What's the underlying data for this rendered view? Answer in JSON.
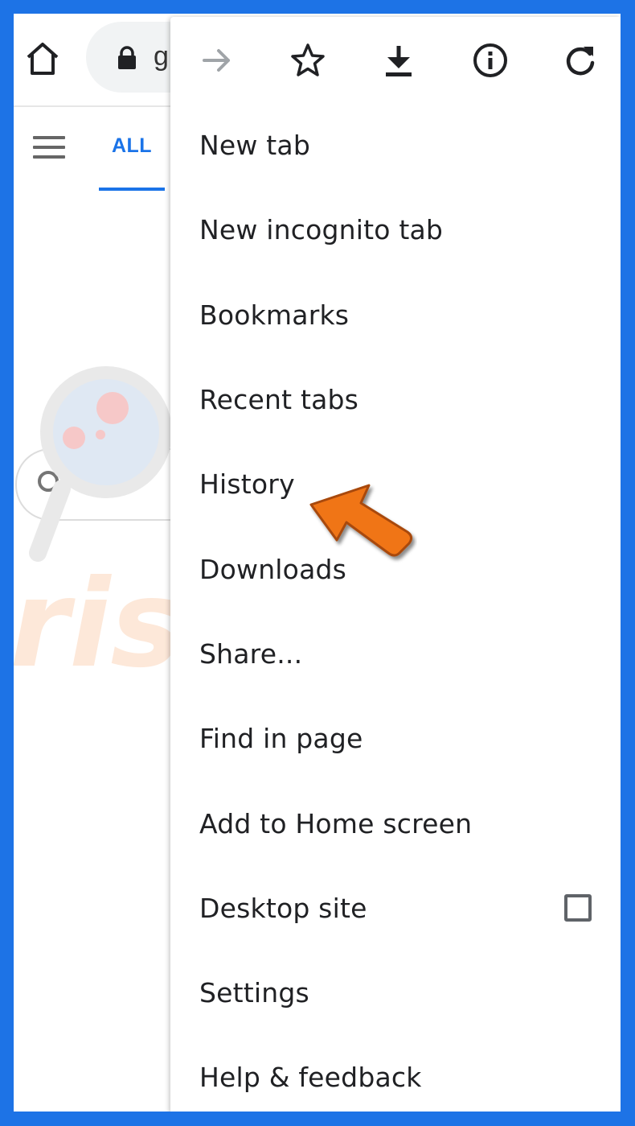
{
  "browser": {
    "url_partial": "g",
    "tabs": {
      "active_label": "ALL"
    }
  },
  "menu": {
    "top_icons": [
      "forward-icon",
      "bookmark-star-icon",
      "download-icon",
      "info-icon",
      "refresh-icon"
    ],
    "items": [
      {
        "label": "New tab"
      },
      {
        "label": "New incognito tab"
      },
      {
        "label": "Bookmarks"
      },
      {
        "label": "Recent tabs"
      },
      {
        "label": "History"
      },
      {
        "label": "Downloads"
      },
      {
        "label": "Share..."
      },
      {
        "label": "Find in page"
      },
      {
        "label": "Add to Home screen"
      },
      {
        "label": "Desktop site",
        "checkbox": false
      },
      {
        "label": "Settings"
      },
      {
        "label": "Help & feedback"
      }
    ]
  },
  "annotation": {
    "arrow_color": "#f07417",
    "highlight_target": "History"
  },
  "watermark": {
    "text": "risk.com"
  },
  "colors": {
    "frame_border": "#1d73e6",
    "accent": "#1a73e8"
  }
}
